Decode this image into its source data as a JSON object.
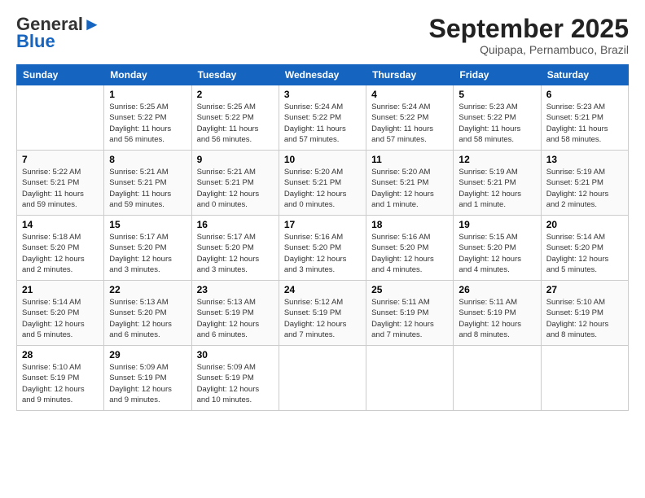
{
  "logo": {
    "line1": "General",
    "line2": "Blue"
  },
  "header": {
    "month": "September 2025",
    "location": "Quipapa, Pernambuco, Brazil"
  },
  "days_of_week": [
    "Sunday",
    "Monday",
    "Tuesday",
    "Wednesday",
    "Thursday",
    "Friday",
    "Saturday"
  ],
  "weeks": [
    [
      {
        "day": "",
        "info": ""
      },
      {
        "day": "1",
        "info": "Sunrise: 5:25 AM\nSunset: 5:22 PM\nDaylight: 11 hours\nand 56 minutes."
      },
      {
        "day": "2",
        "info": "Sunrise: 5:25 AM\nSunset: 5:22 PM\nDaylight: 11 hours\nand 56 minutes."
      },
      {
        "day": "3",
        "info": "Sunrise: 5:24 AM\nSunset: 5:22 PM\nDaylight: 11 hours\nand 57 minutes."
      },
      {
        "day": "4",
        "info": "Sunrise: 5:24 AM\nSunset: 5:22 PM\nDaylight: 11 hours\nand 57 minutes."
      },
      {
        "day": "5",
        "info": "Sunrise: 5:23 AM\nSunset: 5:22 PM\nDaylight: 11 hours\nand 58 minutes."
      },
      {
        "day": "6",
        "info": "Sunrise: 5:23 AM\nSunset: 5:21 PM\nDaylight: 11 hours\nand 58 minutes."
      }
    ],
    [
      {
        "day": "7",
        "info": "Sunrise: 5:22 AM\nSunset: 5:21 PM\nDaylight: 11 hours\nand 59 minutes."
      },
      {
        "day": "8",
        "info": "Sunrise: 5:21 AM\nSunset: 5:21 PM\nDaylight: 11 hours\nand 59 minutes."
      },
      {
        "day": "9",
        "info": "Sunrise: 5:21 AM\nSunset: 5:21 PM\nDaylight: 12 hours\nand 0 minutes."
      },
      {
        "day": "10",
        "info": "Sunrise: 5:20 AM\nSunset: 5:21 PM\nDaylight: 12 hours\nand 0 minutes."
      },
      {
        "day": "11",
        "info": "Sunrise: 5:20 AM\nSunset: 5:21 PM\nDaylight: 12 hours\nand 1 minute."
      },
      {
        "day": "12",
        "info": "Sunrise: 5:19 AM\nSunset: 5:21 PM\nDaylight: 12 hours\nand 1 minute."
      },
      {
        "day": "13",
        "info": "Sunrise: 5:19 AM\nSunset: 5:21 PM\nDaylight: 12 hours\nand 2 minutes."
      }
    ],
    [
      {
        "day": "14",
        "info": "Sunrise: 5:18 AM\nSunset: 5:20 PM\nDaylight: 12 hours\nand 2 minutes."
      },
      {
        "day": "15",
        "info": "Sunrise: 5:17 AM\nSunset: 5:20 PM\nDaylight: 12 hours\nand 3 minutes."
      },
      {
        "day": "16",
        "info": "Sunrise: 5:17 AM\nSunset: 5:20 PM\nDaylight: 12 hours\nand 3 minutes."
      },
      {
        "day": "17",
        "info": "Sunrise: 5:16 AM\nSunset: 5:20 PM\nDaylight: 12 hours\nand 3 minutes."
      },
      {
        "day": "18",
        "info": "Sunrise: 5:16 AM\nSunset: 5:20 PM\nDaylight: 12 hours\nand 4 minutes."
      },
      {
        "day": "19",
        "info": "Sunrise: 5:15 AM\nSunset: 5:20 PM\nDaylight: 12 hours\nand 4 minutes."
      },
      {
        "day": "20",
        "info": "Sunrise: 5:14 AM\nSunset: 5:20 PM\nDaylight: 12 hours\nand 5 minutes."
      }
    ],
    [
      {
        "day": "21",
        "info": "Sunrise: 5:14 AM\nSunset: 5:20 PM\nDaylight: 12 hours\nand 5 minutes."
      },
      {
        "day": "22",
        "info": "Sunrise: 5:13 AM\nSunset: 5:20 PM\nDaylight: 12 hours\nand 6 minutes."
      },
      {
        "day": "23",
        "info": "Sunrise: 5:13 AM\nSunset: 5:19 PM\nDaylight: 12 hours\nand 6 minutes."
      },
      {
        "day": "24",
        "info": "Sunrise: 5:12 AM\nSunset: 5:19 PM\nDaylight: 12 hours\nand 7 minutes."
      },
      {
        "day": "25",
        "info": "Sunrise: 5:11 AM\nSunset: 5:19 PM\nDaylight: 12 hours\nand 7 minutes."
      },
      {
        "day": "26",
        "info": "Sunrise: 5:11 AM\nSunset: 5:19 PM\nDaylight: 12 hours\nand 8 minutes."
      },
      {
        "day": "27",
        "info": "Sunrise: 5:10 AM\nSunset: 5:19 PM\nDaylight: 12 hours\nand 8 minutes."
      }
    ],
    [
      {
        "day": "28",
        "info": "Sunrise: 5:10 AM\nSunset: 5:19 PM\nDaylight: 12 hours\nand 9 minutes."
      },
      {
        "day": "29",
        "info": "Sunrise: 5:09 AM\nSunset: 5:19 PM\nDaylight: 12 hours\nand 9 minutes."
      },
      {
        "day": "30",
        "info": "Sunrise: 5:09 AM\nSunset: 5:19 PM\nDaylight: 12 hours\nand 10 minutes."
      },
      {
        "day": "",
        "info": ""
      },
      {
        "day": "",
        "info": ""
      },
      {
        "day": "",
        "info": ""
      },
      {
        "day": "",
        "info": ""
      }
    ]
  ]
}
